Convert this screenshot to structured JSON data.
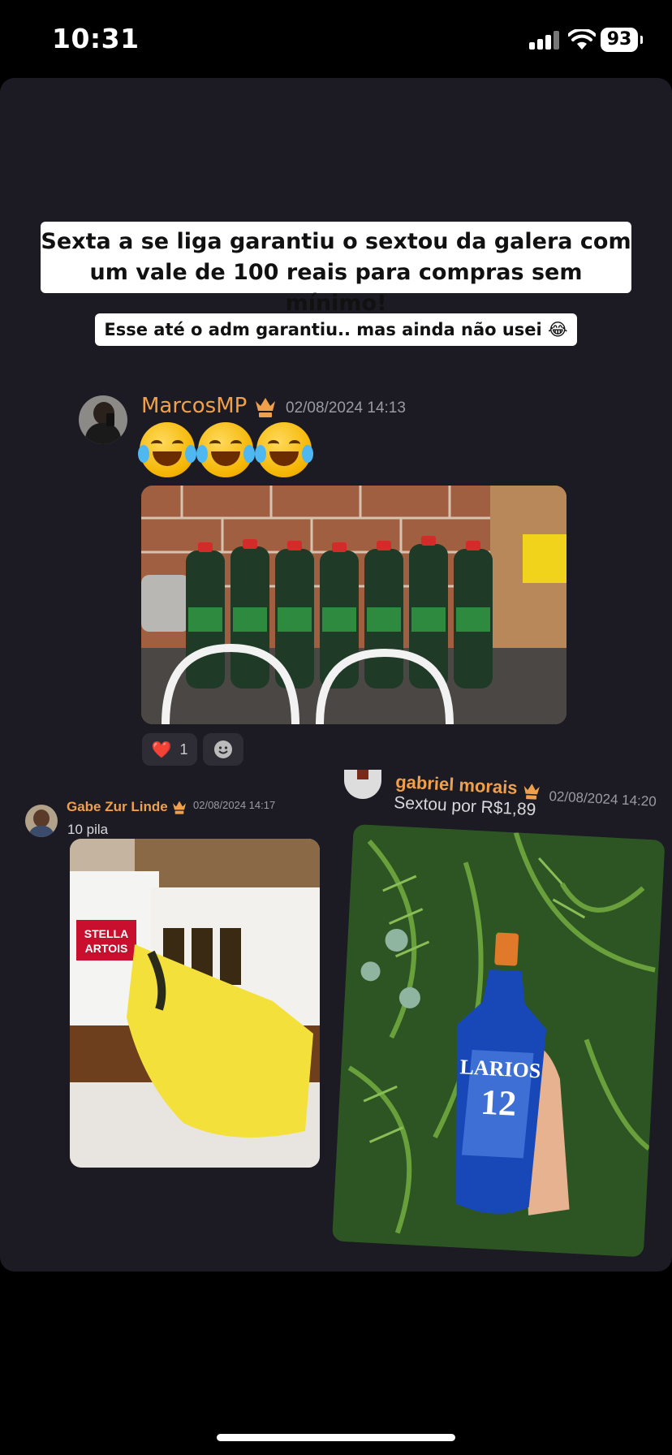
{
  "status_bar": {
    "time": "10:31",
    "battery": "93"
  },
  "captions": {
    "main": "Sexta a se liga garantiu o sextou da galera com um vale de 100 reais para compras sem mínimo!",
    "sub": "Esse até o adm garantiu.. mas ainda não usei 😂"
  },
  "post1": {
    "username": "MarcosMP",
    "timestamp": "02/08/2024 14:13",
    "reaction_count": "1",
    "reaction_emoji": "❤️"
  },
  "post2": {
    "username": "Gabe Zur Linde",
    "timestamp": "02/08/2024 14:17",
    "text": "10 pila",
    "photo_text": {
      "brand": "STELLA ARTOIS"
    }
  },
  "post3": {
    "username": "gabriel morais",
    "timestamp": "02/08/2024 14:20",
    "text": "Sextou por R$1,89",
    "photo_text": {
      "brand": "LARIOS",
      "number": "12"
    }
  },
  "colors": {
    "username": "#f0a04b",
    "panel": "#1c1b23",
    "background": "#000000"
  },
  "icons": [
    "crown-vip-icon",
    "heart-icon",
    "add-reaction-icon",
    "wifi-icon",
    "signal-icon",
    "battery-icon"
  ]
}
